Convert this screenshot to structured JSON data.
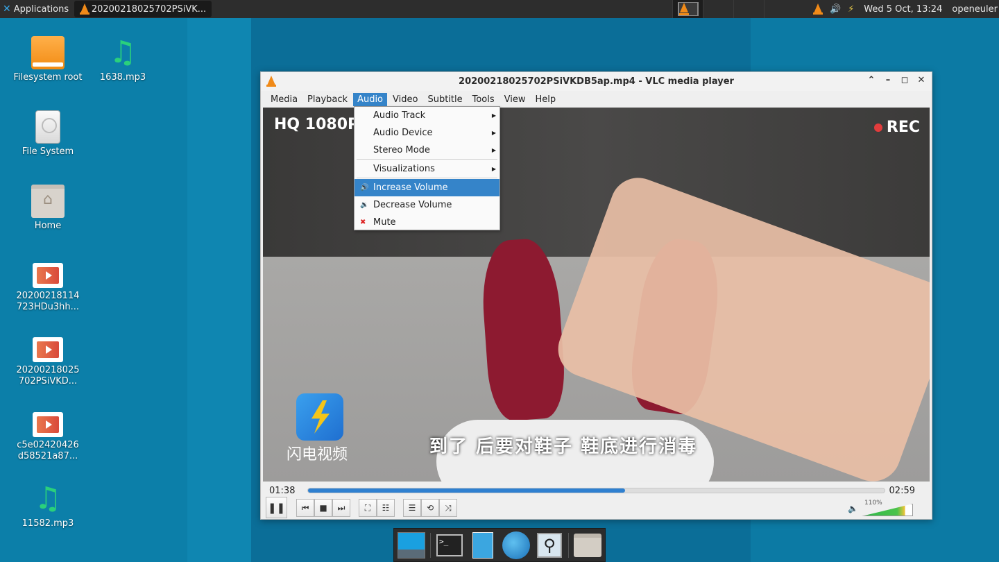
{
  "top_panel": {
    "applications_label": "Applications",
    "task_title": "20200218025702PSiVK...",
    "clock": "Wed  5 Oct, 13:24",
    "user": "openeuler"
  },
  "desktop_icons": [
    {
      "label": "Filesystem root",
      "icon": "filesystem-icon"
    },
    {
      "label": "1638.mp3",
      "icon": "music-icon"
    },
    {
      "label": "File System",
      "icon": "disk-icon"
    },
    {
      "label": "Home",
      "icon": "home-folder-icon"
    },
    {
      "label": "20200218114 723HDu3hh...",
      "icon": "video-file-icon"
    },
    {
      "label": "20200218025 702PSiVKD...",
      "icon": "video-file-icon"
    },
    {
      "label": "c5e02420426 d58521a87...",
      "icon": "video-file-icon"
    },
    {
      "label": "11582.mp3",
      "icon": "music-icon"
    }
  ],
  "vlc": {
    "title": "20200218025702PSiVKDB5ap.mp4 - VLC media player",
    "menu": [
      "Media",
      "Playback",
      "Audio",
      "Video",
      "Subtitle",
      "Tools",
      "View",
      "Help"
    ],
    "open_menu": "Audio",
    "audio_menu": [
      {
        "label": "Audio Track",
        "submenu": true
      },
      {
        "label": "Audio Device",
        "submenu": true
      },
      {
        "label": "Stereo Mode",
        "submenu": true
      },
      {
        "label": "Visualizations",
        "submenu": true
      },
      {
        "label": "Increase Volume",
        "icon": "volume-up-icon",
        "highlighted": true
      },
      {
        "label": "Decrease Volume",
        "icon": "volume-down-icon"
      },
      {
        "label": "Mute",
        "icon": "mute-icon"
      }
    ],
    "video_overlay": {
      "quality": "HQ 1080P",
      "rec": "REC",
      "logo_text": "闪电视频",
      "subtitle": "到了 后要对鞋子 鞋底进行消毒"
    },
    "elapsed": "01:38",
    "duration": "02:59",
    "progress": 0.55,
    "volume_label": "110%",
    "volume_level": 1.1
  },
  "colors": {
    "accent": "#3584c9",
    "vlc_orange": "#f08a18",
    "volume_green": "#2db84a"
  }
}
